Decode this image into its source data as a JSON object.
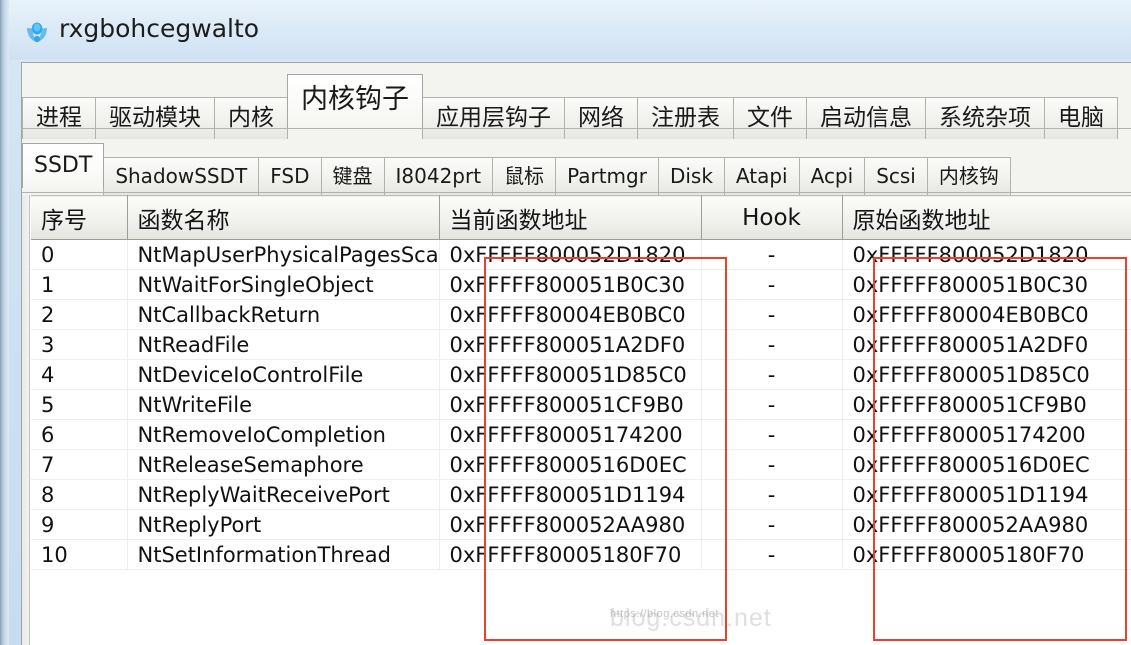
{
  "window": {
    "title": "rxgbohcegwalto",
    "icon": "app-logo-icon"
  },
  "main_tabs": [
    {
      "label": "进程",
      "selected": false
    },
    {
      "label": "驱动模块",
      "selected": false
    },
    {
      "label": "内核",
      "selected": false
    },
    {
      "label": "内核钩子",
      "selected": true
    },
    {
      "label": "应用层钩子",
      "selected": false
    },
    {
      "label": "网络",
      "selected": false
    },
    {
      "label": "注册表",
      "selected": false
    },
    {
      "label": "文件",
      "selected": false
    },
    {
      "label": "启动信息",
      "selected": false
    },
    {
      "label": "系统杂项",
      "selected": false
    },
    {
      "label": "电脑",
      "selected": false
    }
  ],
  "sub_tabs": [
    {
      "label": "SSDT",
      "selected": true
    },
    {
      "label": "ShadowSSDT",
      "selected": false
    },
    {
      "label": "FSD",
      "selected": false
    },
    {
      "label": "键盘",
      "selected": false
    },
    {
      "label": "I8042prt",
      "selected": false
    },
    {
      "label": "鼠标",
      "selected": false
    },
    {
      "label": "Partmgr",
      "selected": false
    },
    {
      "label": "Disk",
      "selected": false
    },
    {
      "label": "Atapi",
      "selected": false
    },
    {
      "label": "Acpi",
      "selected": false
    },
    {
      "label": "Scsi",
      "selected": false
    },
    {
      "label": "内核钩",
      "selected": false
    }
  ],
  "table": {
    "columns": [
      "序号",
      "函数名称",
      "当前函数地址",
      "Hook",
      "原始函数地址"
    ],
    "rows": [
      {
        "index": "0",
        "name": "NtMapUserPhysicalPagesScatter",
        "current": "0xFFFFF800052D1820",
        "hook": "-",
        "original": "0xFFFFF800052D1820"
      },
      {
        "index": "1",
        "name": "NtWaitForSingleObject",
        "current": "0xFFFFF800051B0C30",
        "hook": "-",
        "original": "0xFFFFF800051B0C30"
      },
      {
        "index": "2",
        "name": "NtCallbackReturn",
        "current": "0xFFFFF80004EB0BC0",
        "hook": "-",
        "original": "0xFFFFF80004EB0BC0"
      },
      {
        "index": "3",
        "name": "NtReadFile",
        "current": "0xFFFFF800051A2DF0",
        "hook": "-",
        "original": "0xFFFFF800051A2DF0"
      },
      {
        "index": "4",
        "name": "NtDeviceIoControlFile",
        "current": "0xFFFFF800051D85C0",
        "hook": "-",
        "original": "0xFFFFF800051D85C0"
      },
      {
        "index": "5",
        "name": "NtWriteFile",
        "current": "0xFFFFF800051CF9B0",
        "hook": "-",
        "original": "0xFFFFF800051CF9B0"
      },
      {
        "index": "6",
        "name": "NtRemoveIoCompletion",
        "current": "0xFFFFF80005174200",
        "hook": "-",
        "original": "0xFFFFF80005174200"
      },
      {
        "index": "7",
        "name": "NtReleaseSemaphore",
        "current": "0xFFFFF8000516D0EC",
        "hook": "-",
        "original": "0xFFFFF8000516D0EC"
      },
      {
        "index": "8",
        "name": "NtReplyWaitReceivePort",
        "current": "0xFFFFF800051D1194",
        "hook": "-",
        "original": "0xFFFFF800051D1194"
      },
      {
        "index": "9",
        "name": "NtReplyPort",
        "current": "0xFFFFF800052AA980",
        "hook": "-",
        "original": "0xFFFFF800052AA980"
      },
      {
        "index": "10",
        "name": "NtSetInformationThread",
        "current": "0xFFFFF80005180F70",
        "hook": "-",
        "original": "0xFFFFF80005180F70"
      }
    ]
  },
  "annotations": {
    "highlight_color": "#e8422f",
    "boxes": [
      "current-address-column",
      "original-address-column"
    ]
  },
  "watermark": {
    "small": "https://blog.csdn.net",
    "big": "blog.csdn.net"
  }
}
